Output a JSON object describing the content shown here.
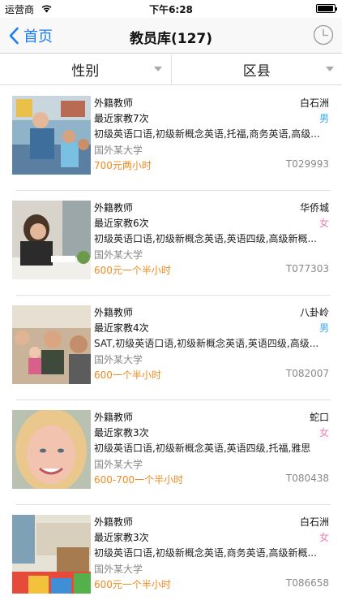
{
  "status_bar": {
    "carrier": "运营商",
    "time": "下午6:28"
  },
  "nav": {
    "back_label": "首页",
    "title": "教员库(127)"
  },
  "filters": [
    {
      "label": "性别"
    },
    {
      "label": "区县"
    }
  ],
  "colors": {
    "accent": "#1a7cf5",
    "price": "#f08a1e",
    "male": "#39a6e8",
    "female": "#f27fb5"
  },
  "teachers": [
    {
      "type": "外籍教师",
      "district": "白石洲",
      "tutor_count": "最近家教7次",
      "gender": "男",
      "subjects": "初级英语口语,初级新概念英语,托福,商务英语,高级...",
      "school": "国外某大学",
      "price": "700元两小时",
      "id": "T029993"
    },
    {
      "type": "外籍教师",
      "district": "华侨城",
      "tutor_count": "最近家教6次",
      "gender": "女",
      "subjects": "初级英语口语,初级新概念英语,英语四级,高级新概...",
      "school": "国外某大学",
      "price": "600元一个半小时",
      "id": "T077303"
    },
    {
      "type": "外籍教师",
      "district": "八卦岭",
      "tutor_count": "最近家教4次",
      "gender": "男",
      "subjects": "SAT,初级英语口语,初级新概念英语,英语四级,高级...",
      "school": "国外某大学",
      "price": "600一个半小时",
      "id": "T082007"
    },
    {
      "type": "外籍教师",
      "district": "蛇口",
      "tutor_count": "最近家教3次",
      "gender": "女",
      "subjects": "初级英语口语,初级新概念英语,英语四级,托福,雅思",
      "school": "国外某大学",
      "price": "600-700一个半小时",
      "id": "T080438"
    },
    {
      "type": "外籍教师",
      "district": "白石洲",
      "tutor_count": "最近家教3次",
      "gender": "女",
      "subjects": "初级英语口语,初级新概念英语,商务英语,高级新概...",
      "school": "国外某大学",
      "price": "600元一个半小时",
      "id": "T086658"
    }
  ]
}
